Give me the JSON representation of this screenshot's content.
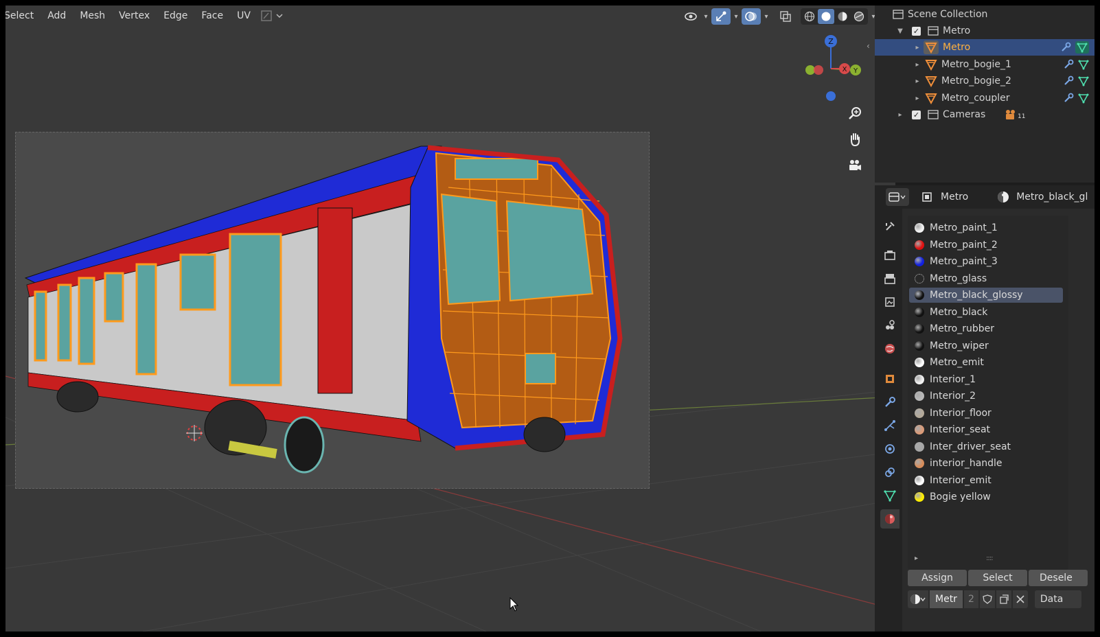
{
  "menu": {
    "items": [
      "Select",
      "Add",
      "Mesh",
      "Vertex",
      "Edge",
      "Face",
      "UV"
    ]
  },
  "viewport": {
    "gizmo_labels": {
      "z": "Z",
      "x": "X",
      "y": "Y"
    },
    "icons": [
      "visibility-icon",
      "gizmo-icon",
      "overlay-icon",
      "xray-icon",
      "wireframe-shading-icon",
      "solid-shading-icon",
      "material-shading-icon",
      "rendered-shading-icon",
      "zoom-icon",
      "pan-hand-icon",
      "camera-view-icon"
    ],
    "active_shading": "solid"
  },
  "outliner": {
    "root": "Scene Collection",
    "rows": [
      {
        "label": "Metro",
        "kind": "collection",
        "checked": true
      },
      {
        "label": "Metro",
        "kind": "mesh",
        "selected": true
      },
      {
        "label": "Metro_bogie_1",
        "kind": "mesh"
      },
      {
        "label": "Metro_bogie_2",
        "kind": "mesh"
      },
      {
        "label": "Metro_coupler",
        "kind": "mesh"
      },
      {
        "label": "Cameras",
        "kind": "collection",
        "checked": true,
        "badge": "11"
      }
    ]
  },
  "properties": {
    "object_name": "Metro",
    "material_name": "Metro_black_gl",
    "materials": [
      {
        "name": "Metro_paint_1",
        "color": "#f2f2f2"
      },
      {
        "name": "Metro_paint_2",
        "color": "#e01010"
      },
      {
        "name": "Metro_paint_3",
        "color": "#1020e0"
      },
      {
        "name": "Metro_glass",
        "color": "transparent"
      },
      {
        "name": "Metro_black_glossy",
        "color": "#111111",
        "active": true
      },
      {
        "name": "Metro_black",
        "color": "#111111"
      },
      {
        "name": "Metro_rubber",
        "color": "#111111"
      },
      {
        "name": "Metro_wiper",
        "color": "#111111"
      },
      {
        "name": "Metro_emit",
        "color": "#ffffff"
      },
      {
        "name": "Interior_1",
        "color": "#f0f0f0"
      },
      {
        "name": "Interior_2",
        "color": "#b8b8b8"
      },
      {
        "name": "Interior_floor",
        "color": "#b3a999"
      },
      {
        "name": "Interior_seat",
        "color": "#d99a78"
      },
      {
        "name": "Inter_driver_seat",
        "color": "#a6a6a6"
      },
      {
        "name": "interior_handle",
        "color": "#d88d5a"
      },
      {
        "name": "Interior_emit",
        "color": "#ffffff"
      },
      {
        "name": "Bogie yellow",
        "color": "#ffee00"
      }
    ],
    "buttons": {
      "assign": "Assign",
      "select": "Select",
      "deselect": "Desele"
    },
    "slot": {
      "name": "Metr",
      "users": "2",
      "link": "Data"
    }
  },
  "colors": {
    "accent": "#5a7fb5",
    "selected_row": "#334d80",
    "selected_text": "#ffb13f"
  }
}
